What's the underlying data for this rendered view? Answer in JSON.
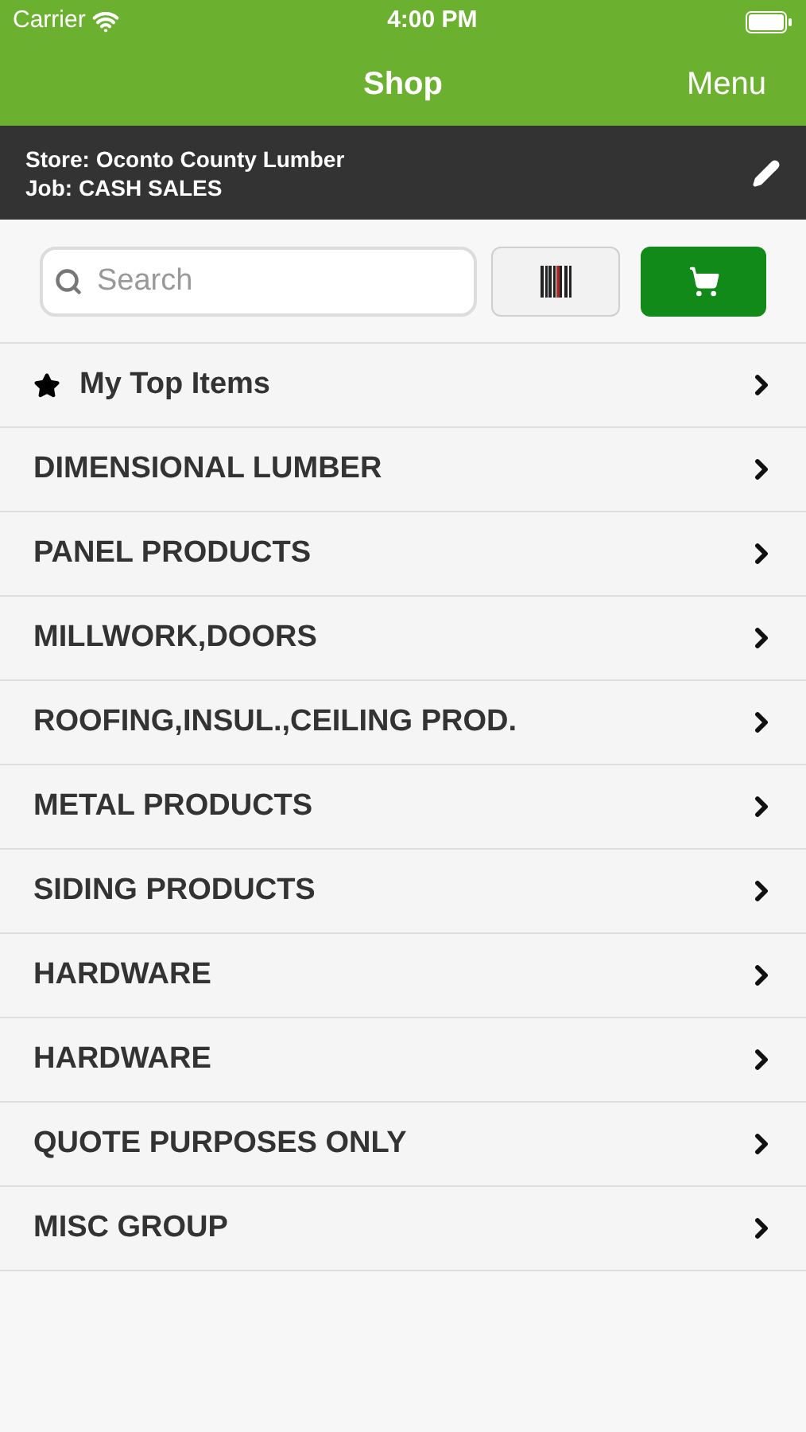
{
  "status_bar": {
    "carrier": "Carrier",
    "time": "4:00 PM"
  },
  "nav": {
    "title": "Shop",
    "menu": "Menu"
  },
  "store": {
    "store": "Store: Oconto County Lumber",
    "job": "Job: CASH SALES"
  },
  "search": {
    "placeholder": "Search"
  },
  "categories": [
    {
      "label": "My Top Items",
      "kind": "favorite"
    },
    {
      "label": "DIMENSIONAL LUMBER",
      "kind": "category"
    },
    {
      "label": "PANEL PRODUCTS",
      "kind": "category"
    },
    {
      "label": "MILLWORK,DOORS",
      "kind": "category"
    },
    {
      "label": "ROOFING,INSUL.,CEILING PROD.",
      "kind": "category"
    },
    {
      "label": "METAL PRODUCTS",
      "kind": "category"
    },
    {
      "label": "SIDING PRODUCTS",
      "kind": "category"
    },
    {
      "label": "HARDWARE",
      "kind": "category"
    },
    {
      "label": "HARDWARE",
      "kind": "category"
    },
    {
      "label": "QUOTE PURPOSES ONLY",
      "kind": "category"
    },
    {
      "label": "MISC GROUP",
      "kind": "category"
    }
  ]
}
